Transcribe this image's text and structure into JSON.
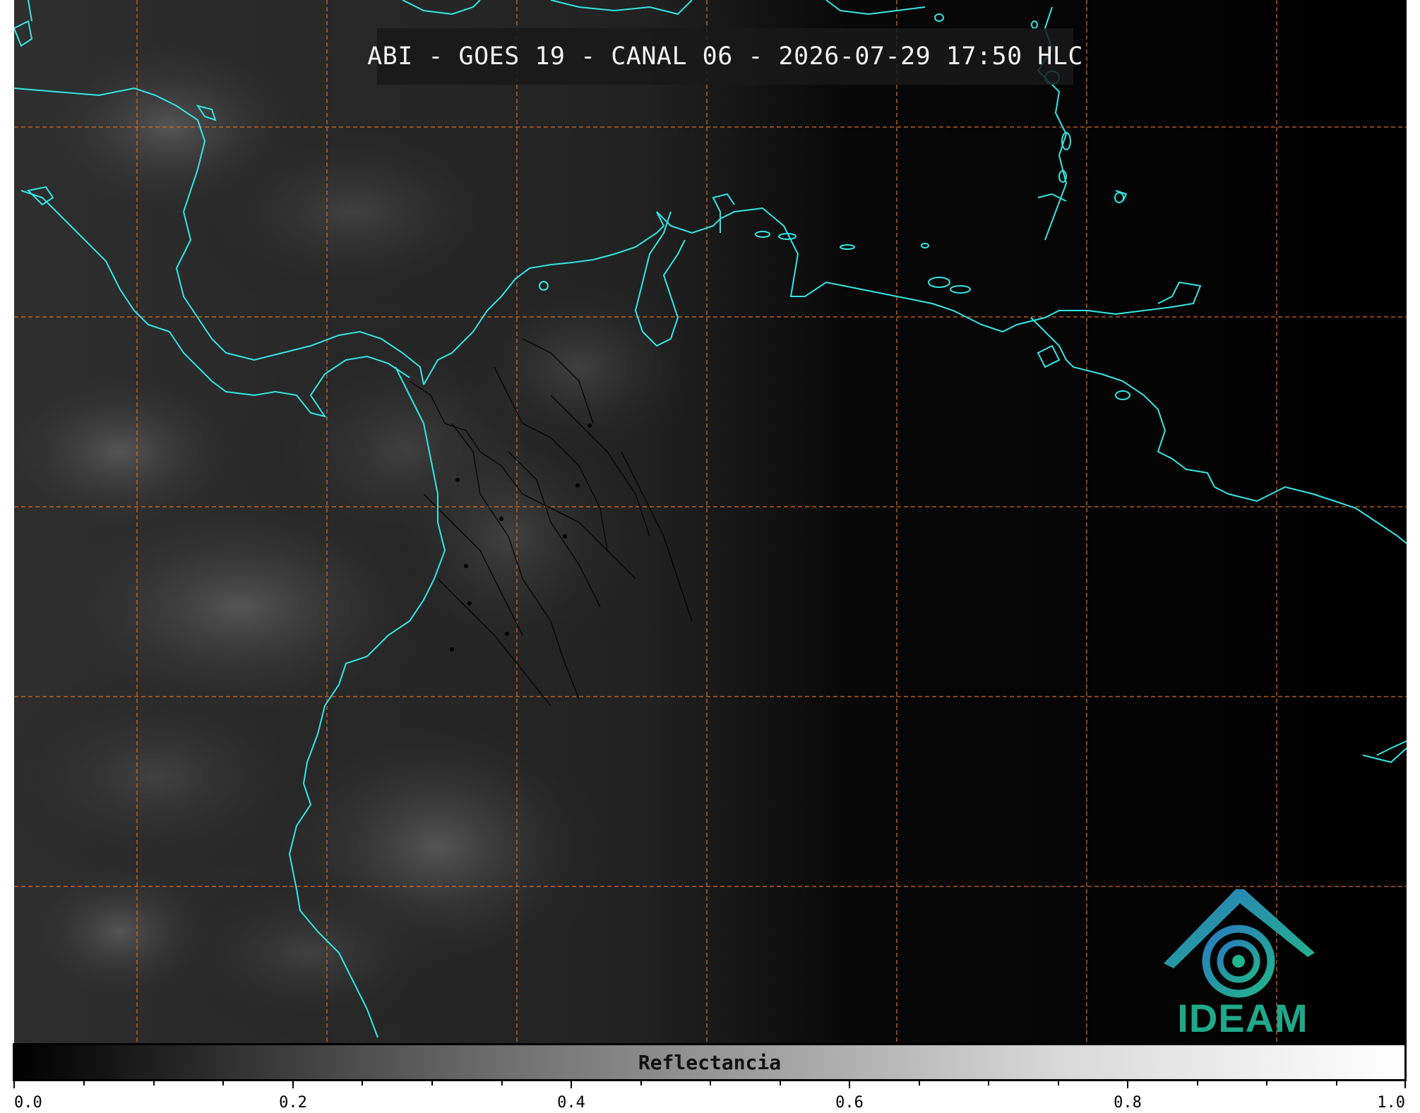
{
  "title": "ABI - GOES 19 - CANAL 06 - 2026-07-29 17:50 HLC",
  "logo": {
    "name": "IDEAM",
    "icon": "ideam-spiral-roof-logo",
    "colors": [
      "#2a7bbf",
      "#22b48a"
    ]
  },
  "colorbar": {
    "label": "Reflectancia",
    "ticks": [
      "0.0",
      "0.2",
      "0.4",
      "0.6",
      "0.8",
      "1.0"
    ],
    "min": 0.0,
    "max": 1.0,
    "colors": [
      "#000000",
      "#ffffff"
    ]
  },
  "map_style": {
    "coastline_color": "#33e6e6",
    "grid_color": "#d2691e",
    "border_color": "#000000",
    "background": "#000000"
  }
}
